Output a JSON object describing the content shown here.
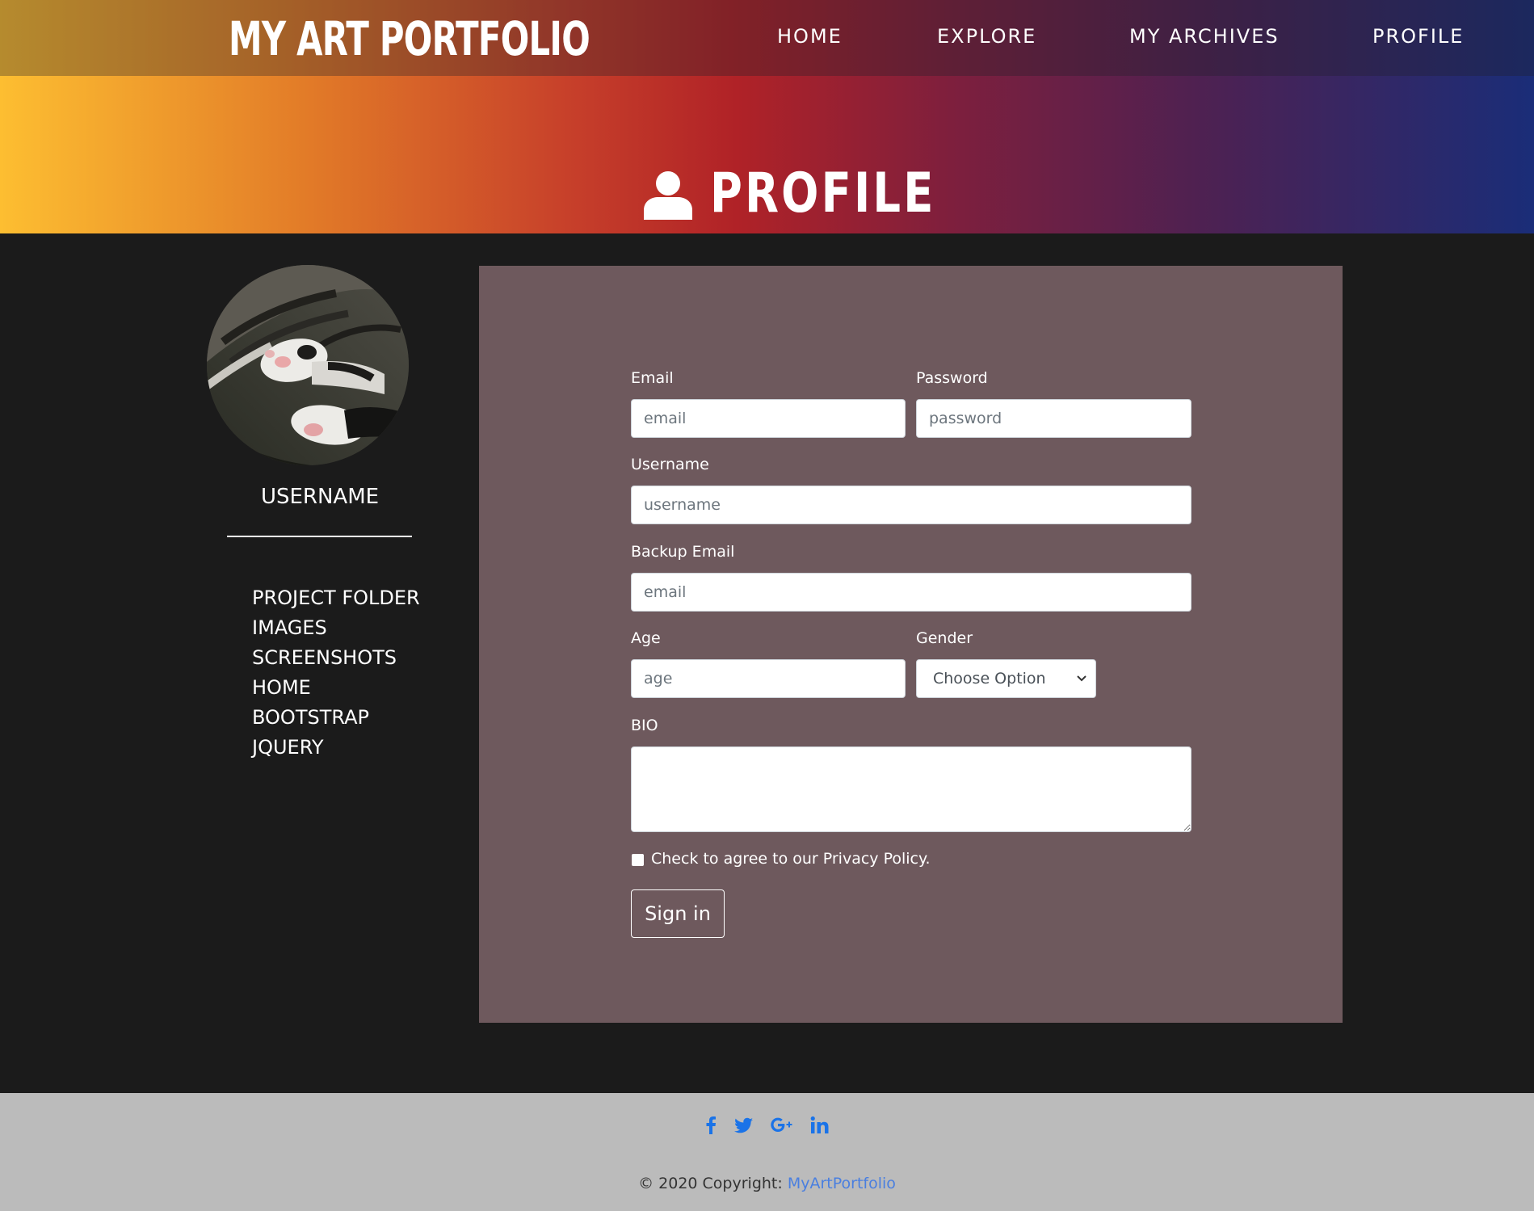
{
  "brand": "MY ART PORTFOLIO",
  "nav": [
    {
      "label": "HOME"
    },
    {
      "label": "EXPLORE"
    },
    {
      "label": "MY ARCHIVES"
    },
    {
      "label": "PROFILE"
    }
  ],
  "hero": {
    "title": "PROFILE",
    "icon": "user-icon"
  },
  "sidebar": {
    "avatar_icon": "cat-photo",
    "username": "USERNAME",
    "links": [
      "PROJECT FOLDER",
      "IMAGES",
      "SCREENSHOTS",
      "HOME",
      "BOOTSTRAP",
      "JQUERY"
    ]
  },
  "form": {
    "email": {
      "label": "Email",
      "placeholder": "email"
    },
    "password": {
      "label": "Password",
      "placeholder": "password"
    },
    "username": {
      "label": "Username",
      "placeholder": "username"
    },
    "backup_email": {
      "label": "Backup Email",
      "placeholder": "email"
    },
    "age": {
      "label": "Age",
      "placeholder": "age"
    },
    "gender": {
      "label": "Gender",
      "selected": "Choose Option"
    },
    "bio": {
      "label": "BIO"
    },
    "privacy": {
      "label": "Check to agree to our Privacy Policy.",
      "checked": false
    },
    "submit": "Sign in"
  },
  "footer": {
    "social_icons": [
      "facebook-icon",
      "twitter-icon",
      "google-plus-icon",
      "linkedin-icon"
    ],
    "copyright_prefix": "© 2020 Copyright: ",
    "copyright_link": "MyArtPortfolio"
  },
  "colors": {
    "card": "#6e595d",
    "page": "#1b1b1b",
    "footer": "#bbbbbb",
    "social": "#1a73e8",
    "link": "#4a7fe0"
  }
}
